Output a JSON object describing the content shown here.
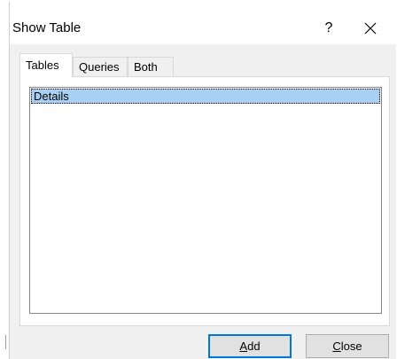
{
  "window": {
    "title": "Show Table",
    "help_label": "?"
  },
  "tabs": [
    {
      "label": "Tables",
      "active": true
    },
    {
      "label": "Queries",
      "active": false
    },
    {
      "label": "Both",
      "active": false
    }
  ],
  "list": {
    "items": [
      {
        "label": "Details",
        "selected": true
      }
    ]
  },
  "buttons": {
    "add": {
      "mnemonic": "A",
      "rest": "dd"
    },
    "close": {
      "mnemonic": "C",
      "rest": "lose"
    }
  },
  "colors": {
    "selection": "#a9d0f2",
    "default_button_border": "#0078d7",
    "dialog_background": "#f0f0f0"
  },
  "icons": {
    "close": "close-icon"
  }
}
